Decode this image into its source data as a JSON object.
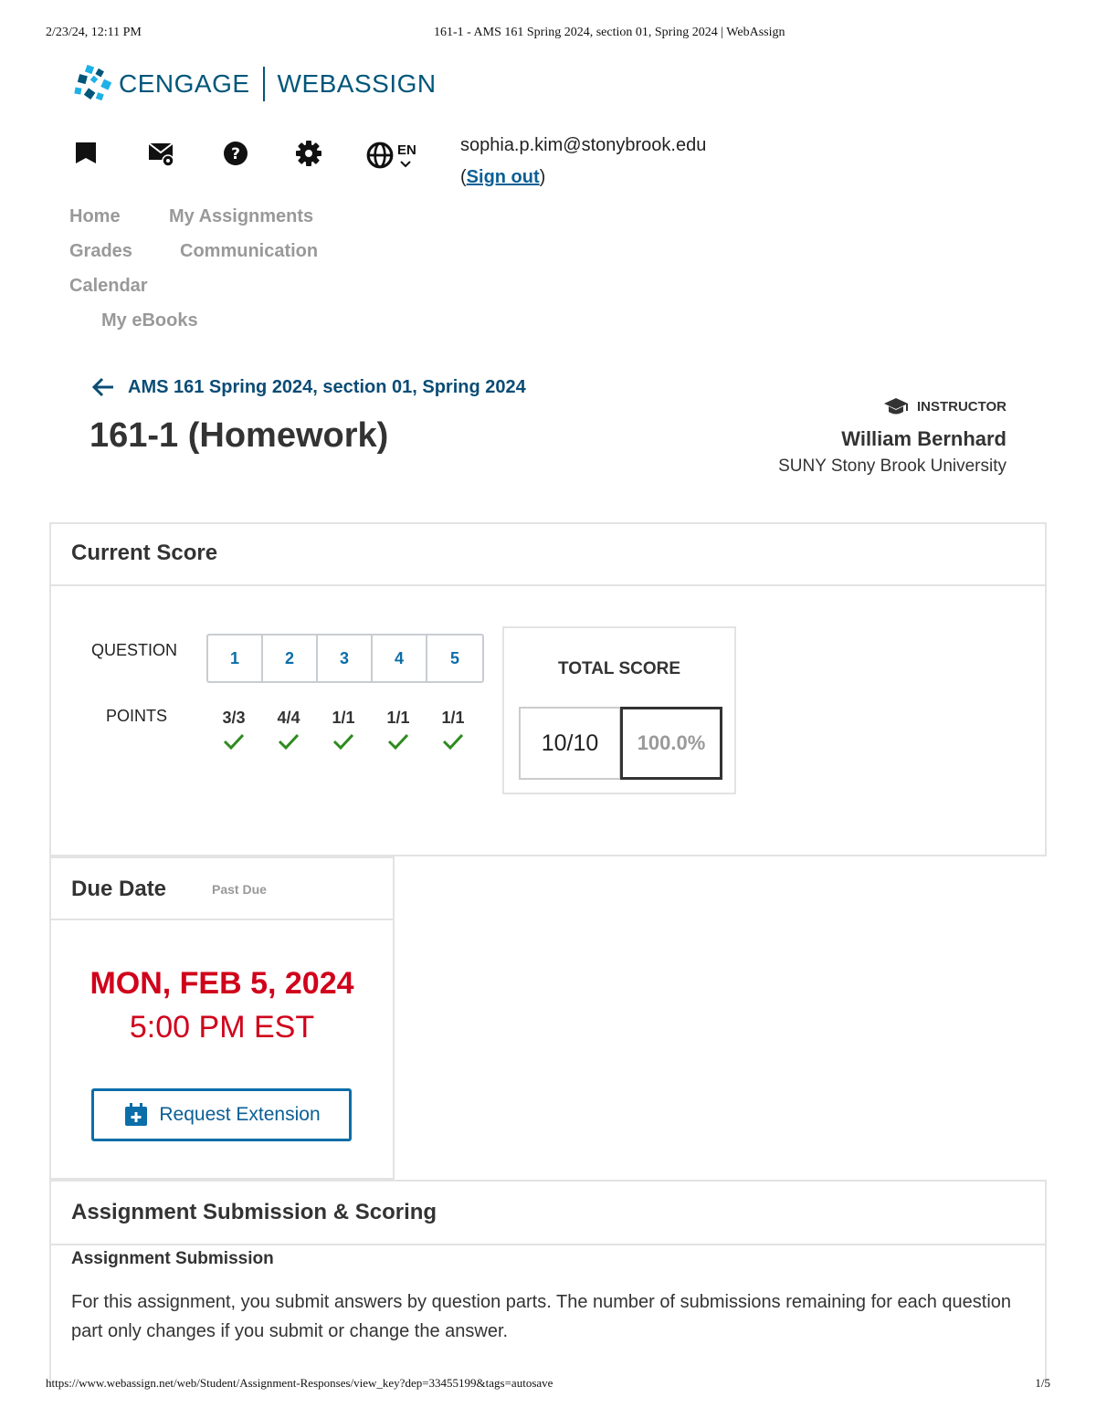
{
  "print_header": {
    "datetime": "2/23/24, 12:11 PM",
    "title": "161-1 - AMS 161 Spring 2024, section 01, Spring 2024 | WebAssign"
  },
  "print_footer": {
    "url": "https://www.webassign.net/web/Student/Assignment-Responses/view_key?dep=33455199&tags=autosave",
    "page": "1/5"
  },
  "logo": {
    "left": "CENGAGE",
    "right": "WEBASSIGN"
  },
  "toolbar": {
    "icons": [
      "flag-icon",
      "messages-icon",
      "help-icon",
      "settings-icon",
      "globe-icon"
    ],
    "language": "EN"
  },
  "user": {
    "email": "sophia.p.kim@stonybrook.edu",
    "open_paren": "(",
    "sign_out": "Sign out",
    "close_paren": ")"
  },
  "nav": {
    "home": "Home",
    "my_assignments": "My Assignments",
    "grades": "Grades",
    "communication": "Communication",
    "calendar": "Calendar",
    "my_ebooks": "My eBooks"
  },
  "course": {
    "back_link": "AMS 161 Spring 2024, section 01, Spring 2024",
    "assignment_title": "161-1 (Homework)"
  },
  "instructor": {
    "label": "INSTRUCTOR",
    "name": "William Bernhard",
    "school": "SUNY Stony Brook University"
  },
  "current_score": {
    "heading": "Current Score",
    "question_label": "QUESTION",
    "points_label": "POINTS",
    "questions": [
      "1",
      "2",
      "3",
      "4",
      "5"
    ],
    "points": [
      "3/3",
      "4/4",
      "1/1",
      "1/1",
      "1/1"
    ],
    "total_label": "TOTAL SCORE",
    "total_raw": "10/10",
    "total_percent": "100.0%"
  },
  "due": {
    "heading": "Due Date",
    "status": "Past Due",
    "date": "MON, FEB 5, 2024",
    "time": "5:00 PM EST",
    "extension_button": "Request Extension"
  },
  "submission": {
    "heading": "Assignment Submission & Scoring",
    "subheading": "Assignment Submission",
    "body": "For this assignment, you submit answers by question parts. The number of submissions remaining for each question part only changes if you submit or change the answer."
  },
  "colors": {
    "brand": "#00567a",
    "link": "#0b6ea8",
    "due_red": "#d0021b",
    "check_green": "#2e8b1f"
  }
}
